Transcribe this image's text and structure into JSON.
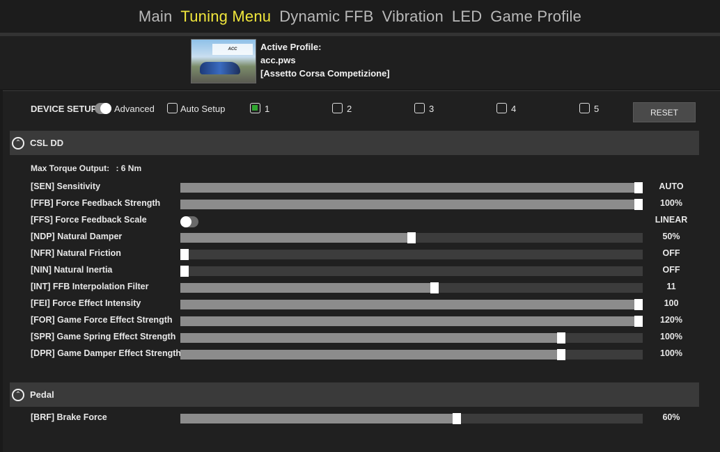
{
  "nav": {
    "tabs": [
      {
        "label": "Main",
        "active": false
      },
      {
        "label": "Tuning Menu",
        "active": true
      },
      {
        "label": "Dynamic FFB",
        "active": false
      },
      {
        "label": "Vibration",
        "active": false
      },
      {
        "label": "LED",
        "active": false
      },
      {
        "label": "Game Profile",
        "active": false
      }
    ],
    "active_color": "#f0e63c"
  },
  "profile": {
    "heading": "Active Profile:",
    "file": "acc.pws",
    "game": "[Assetto Corsa Competizione]"
  },
  "setup": {
    "label": "DEVICE SETUP:",
    "advanced_label": "Advanced",
    "auto_setup_label": "Auto Setup",
    "slots": [
      "1",
      "2",
      "3",
      "4",
      "5"
    ],
    "selected_slot": "1",
    "reset_label": "RESET"
  },
  "csl": {
    "title": "CSL DD",
    "max_torque_label": "Max Torque Output:",
    "max_torque_value": ": 6 Nm",
    "params": [
      {
        "label": "[SEN] Sensitivity",
        "value": "AUTO",
        "level": 1.0
      },
      {
        "label": "[FFB] Force Feedback Strength",
        "value": "100%",
        "level": 1.0
      },
      {
        "label": "[FFS] Force Feedback Scale",
        "value": "LINEAR",
        "toggle": true
      },
      {
        "label": "[NDP] Natural Damper",
        "value": "50%",
        "level": 0.5
      },
      {
        "label": "[NFR] Natural Friction",
        "value": "OFF",
        "level": 0.0
      },
      {
        "label": "[NIN] Natural Inertia",
        "value": "OFF",
        "level": 0.0
      },
      {
        "label": "[INT] FFB Interpolation Filter",
        "value": "11",
        "level": 0.55
      },
      {
        "label": "[FEI] Force Effect Intensity",
        "value": "100",
        "level": 1.0
      },
      {
        "label": "[FOR] Game Force Effect Strength",
        "value": "120%",
        "level": 1.0
      },
      {
        "label": "[SPR] Game Spring Effect Strength",
        "value": "100%",
        "level": 0.83
      },
      {
        "label": "[DPR] Game Damper Effect Strength",
        "value": "100%",
        "level": 0.83
      }
    ]
  },
  "pedal": {
    "title": "Pedal",
    "params": [
      {
        "label": "[BRF] Brake Force",
        "value": "60%",
        "level": 0.6
      }
    ]
  }
}
